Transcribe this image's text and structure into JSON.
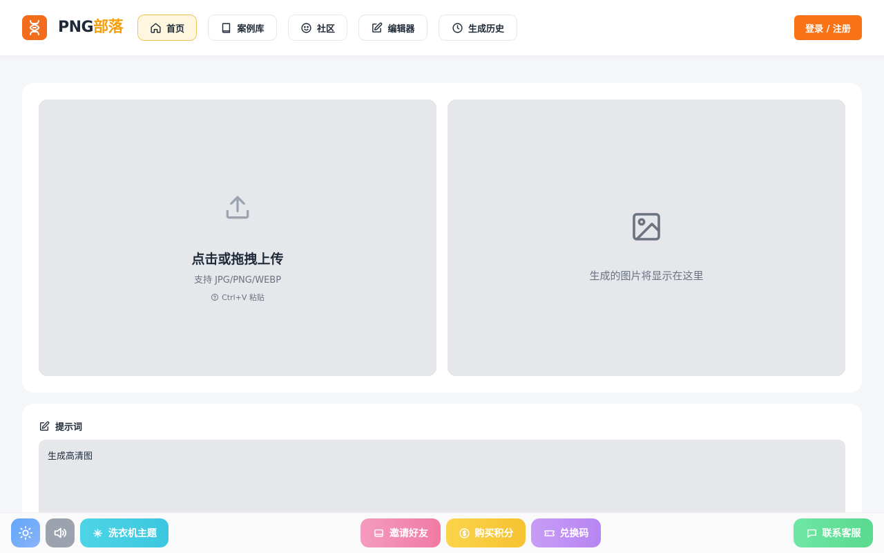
{
  "brand": {
    "name_part1": "PNG",
    "name_part2": "部落"
  },
  "nav": {
    "home": "首页",
    "cases": "案例库",
    "community": "社区",
    "editor": "编辑器",
    "history": "生成历史"
  },
  "header": {
    "login_label": "登录 / 注册"
  },
  "upload": {
    "title": "点击或拖拽上传",
    "formats": "支持 JPG/PNG/WEBP",
    "paste_hint": "Ctrl+V 粘贴"
  },
  "result": {
    "placeholder": "生成的图片将显示在这里"
  },
  "prompt": {
    "label": "提示词",
    "value": "生成高清图"
  },
  "bottom": {
    "theme_label": "洗衣机主题",
    "invite_label": "邀请好友",
    "buy_label": "购买积分",
    "redeem_label": "兑换码",
    "support_label": "联系客服"
  },
  "colors": {
    "accent": "#f97316",
    "brand_gold": "#f59e0b",
    "active_nav_bg": "#fef6df"
  },
  "icons": {
    "logo": "dna-logo-icon",
    "home": "home-icon",
    "cases": "book-icon",
    "community": "smile-icon",
    "editor": "edit-icon",
    "history": "clock-icon",
    "upload": "upload-icon",
    "image": "image-icon",
    "help": "help-circle-icon",
    "sun": "sun-icon",
    "volume": "volume-icon",
    "sparkle": "sparkle-icon",
    "invite": "tv-icon",
    "coin": "coin-icon",
    "ticket": "ticket-icon",
    "chat": "chat-icon"
  }
}
